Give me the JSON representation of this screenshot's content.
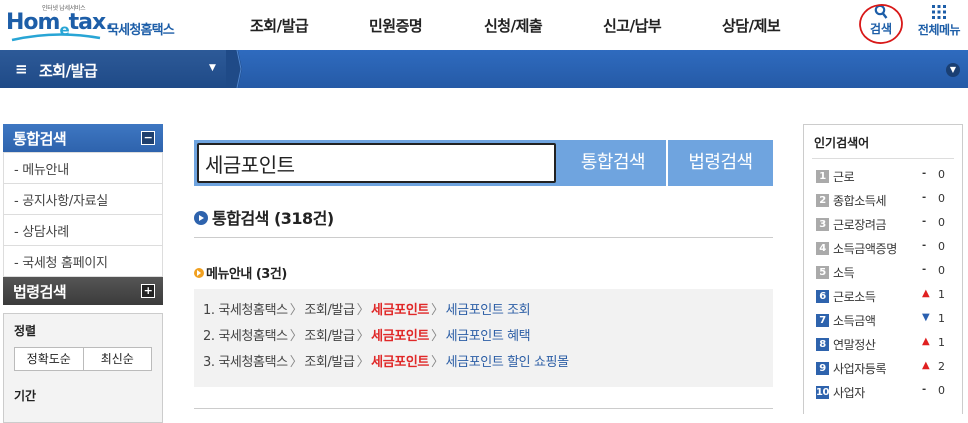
{
  "header": {
    "logo_tagline": "인터넷 납세서비스",
    "logo_word_pre": "Hom",
    "logo_word_e": "e",
    "logo_word_post": "tax.",
    "logo_korean": "국세청홈택스",
    "nav": [
      "조회/발급",
      "민원증명",
      "신청/제출",
      "신고/납부",
      "상담/제보"
    ],
    "search_label": "검색",
    "all_menu_label": "전체메뉴"
  },
  "location": {
    "title": "조회/발급"
  },
  "left_panel": {
    "section1_title": "통합검색",
    "section1_toggle": "−",
    "items": [
      "- 메뉴안내",
      "- 공지사항/자료실",
      "- 상담사례",
      "- 국세청 홈페이지"
    ],
    "section2_title": "법령검색",
    "section2_toggle": "+",
    "sort_label": "정렬",
    "sort_options": [
      "정확도순",
      "최신순"
    ],
    "period_label": "기간"
  },
  "search": {
    "query": "세금포인트",
    "btn_total": "통합검색",
    "btn_law": "법령검색"
  },
  "results": {
    "title": "통합검색 (318건)",
    "menu_section_title": "메뉴안내 (3건)",
    "menu_rows": [
      {
        "num": "1.",
        "p1": "국세청홈택스",
        "p2": "조회/발급",
        "hl": "세금포인트",
        "last": "세금포인트 조회"
      },
      {
        "num": "2.",
        "p1": "국세청홈택스",
        "p2": "조회/발급",
        "hl": "세금포인트",
        "last": "세금포인트 혜택"
      },
      {
        "num": "3.",
        "p1": "국세청홈택스",
        "p2": "조회/발급",
        "hl": "세금포인트",
        "last": "세금포인트 할인 쇼핑몰"
      }
    ]
  },
  "popular": {
    "title": "인기검색어",
    "items": [
      {
        "rank": "1",
        "word": "근로",
        "trend": "same",
        "trend_symbol": "-",
        "change": "0"
      },
      {
        "rank": "2",
        "word": "종합소득세",
        "trend": "same",
        "trend_symbol": "-",
        "change": "0"
      },
      {
        "rank": "3",
        "word": "근로장려금",
        "trend": "same",
        "trend_symbol": "-",
        "change": "0"
      },
      {
        "rank": "4",
        "word": "소득금액증명",
        "trend": "same",
        "trend_symbol": "-",
        "change": "0"
      },
      {
        "rank": "5",
        "word": "소득",
        "trend": "same",
        "trend_symbol": "-",
        "change": "0"
      },
      {
        "rank": "6",
        "word": "근로소득",
        "trend": "up",
        "trend_symbol": "▲",
        "change": "1"
      },
      {
        "rank": "7",
        "word": "소득금액",
        "trend": "down",
        "trend_symbol": "▼",
        "change": "1"
      },
      {
        "rank": "8",
        "word": "연말정산",
        "trend": "up",
        "trend_symbol": "▲",
        "change": "1"
      },
      {
        "rank": "9",
        "word": "사업자등록",
        "trend": "up",
        "trend_symbol": "▲",
        "change": "2"
      },
      {
        "rank": "10",
        "word": "사업자",
        "trend": "same",
        "trend_symbol": "-",
        "change": "0"
      }
    ]
  },
  "colors": {
    "brand_blue": "#1d5ea8",
    "highlight_red": "#e02828",
    "search_bar": "#6fa4df"
  }
}
